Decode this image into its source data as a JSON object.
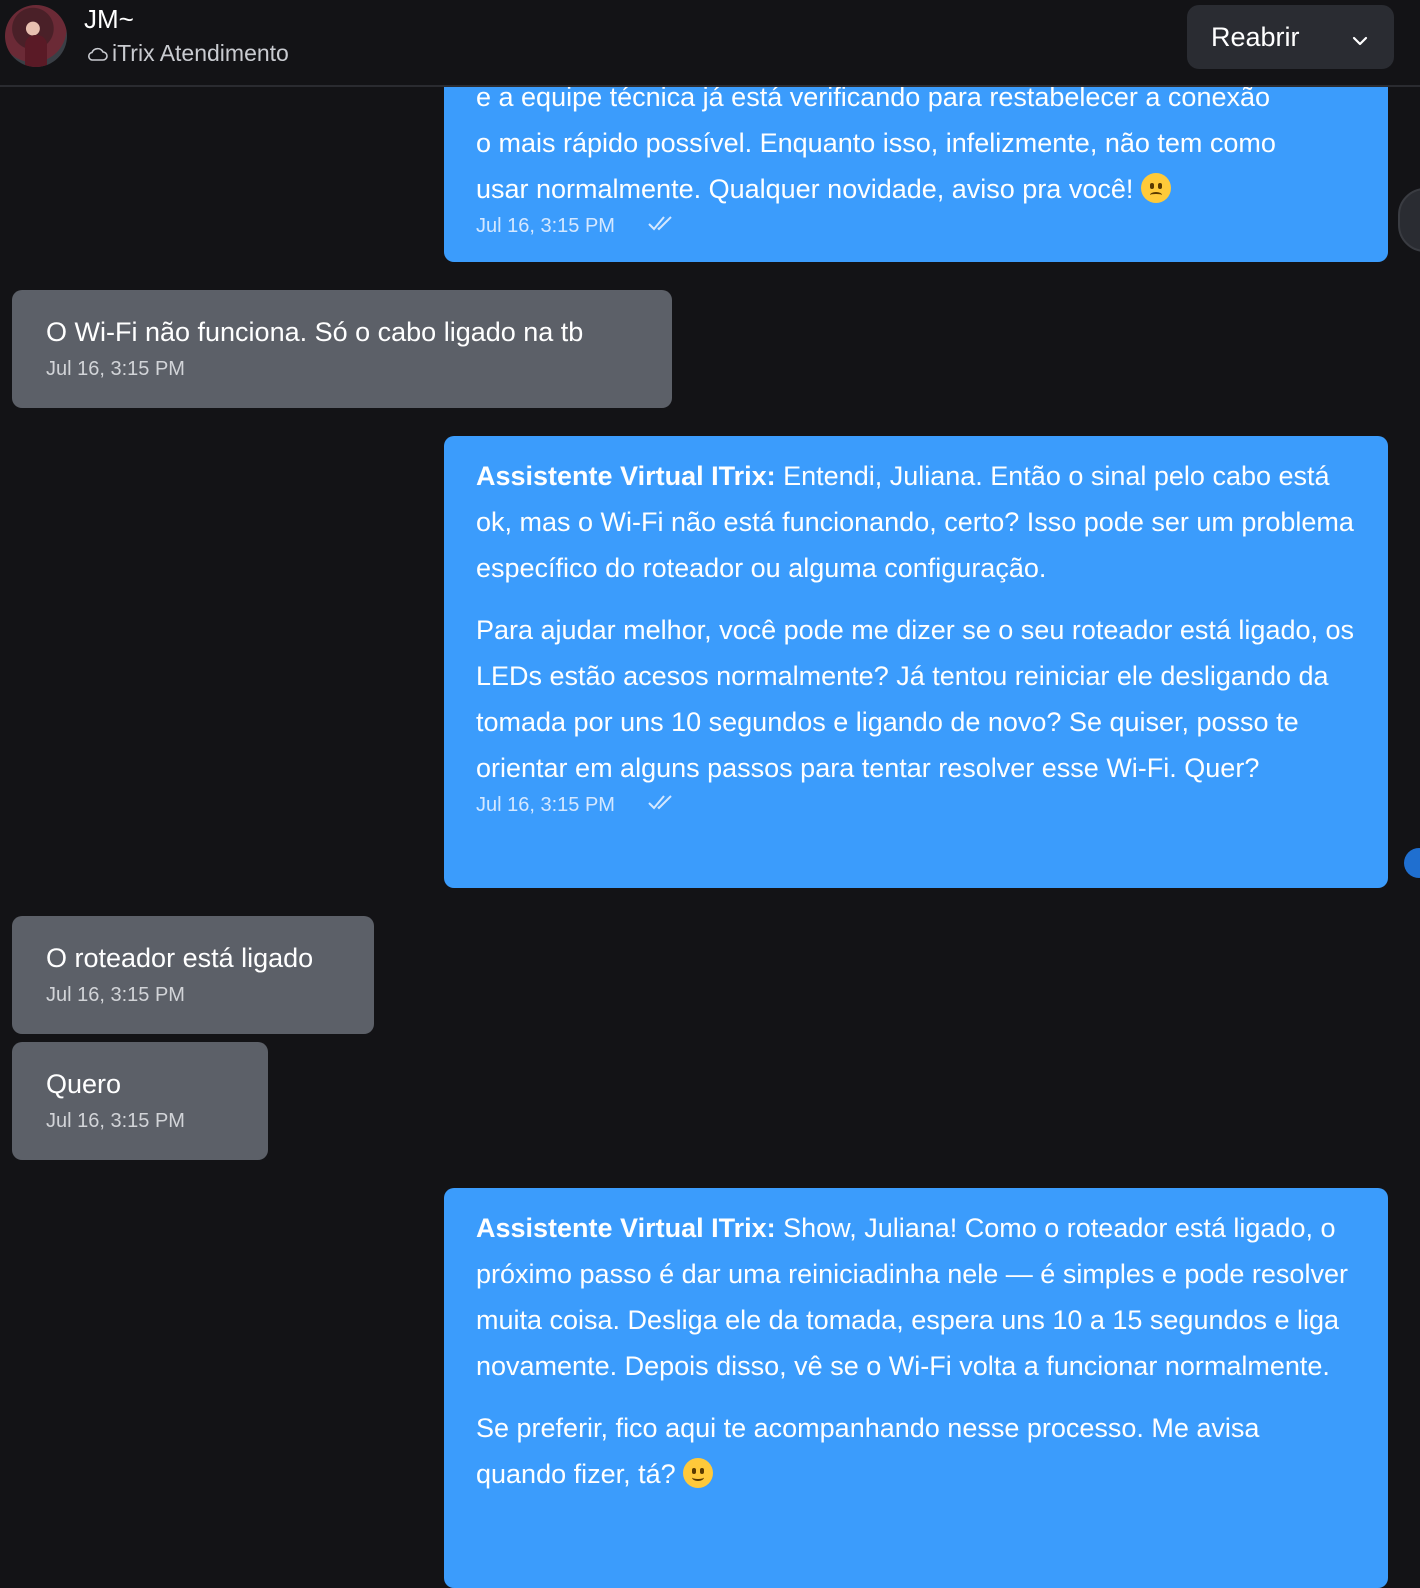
{
  "header": {
    "contact_name": "JM~",
    "inbox_name": "iTrix Atendimento",
    "action_label": "Reabrir"
  },
  "icons": {
    "inbox": "cloud-icon",
    "dropdown": "chevron-down-icon",
    "delivery": "double-check-icon",
    "emoji_confused": "confused-face-emoji",
    "emoji_smile": "smiling-face-emoji"
  },
  "colors": {
    "background": "#131316",
    "outgoing_bubble": "#3b9cfc",
    "incoming_bubble": "#5c6068",
    "header_button": "#2a2c32"
  },
  "messages": [
    {
      "direction": "outgoing",
      "lines": [
        "e a equipe técnica já está verificando para restabelecer a conexão",
        "o mais rápido possível. Enquanto isso, infelizmente, não tem como",
        "usar normalmente. Qualquer novidade, aviso pra você!"
      ],
      "time": "Jul 16, 3:15 PM"
    },
    {
      "direction": "incoming",
      "text": "O Wi-Fi não funciona. Só o cabo ligado na tb",
      "time": "Jul 16, 3:15 PM"
    },
    {
      "direction": "outgoing",
      "sender": "Assistente Virtual ITrix:",
      "p1": "Entendi, Juliana. Então o sinal pelo cabo está ok, mas o Wi-Fi não está funcionando, certo? Isso pode ser um problema específico do roteador ou alguma configuração.",
      "p2": "Para ajudar melhor, você pode me dizer se o seu roteador está ligado, os LEDs estão acesos normalmente? Já tentou reiniciar ele desligando da tomada por uns 10 segundos e ligando de novo? Se quiser, posso te orientar em alguns passos para tentar resolver esse Wi-Fi. Quer?",
      "time": "Jul 16, 3:15 PM"
    },
    {
      "direction": "incoming",
      "text": "O roteador está ligado",
      "time": "Jul 16, 3:15 PM"
    },
    {
      "direction": "incoming",
      "text": "Quero",
      "time": "Jul 16, 3:15 PM"
    },
    {
      "direction": "outgoing",
      "sender": "Assistente Virtual ITrix:",
      "p1": "Show, Juliana! Como o roteador está ligado, o próximo passo é dar uma reiniciadinha nele — é simples e pode resolver muita coisa. Desliga ele da tomada, espera uns 10 a 15 segundos e liga novamente. Depois disso, vê se o Wi-Fi volta a funcionar normalmente.",
      "p2": "Se preferir, fico aqui te acompanhando nesse processo. Me avisa quando fizer, tá?"
    }
  ]
}
